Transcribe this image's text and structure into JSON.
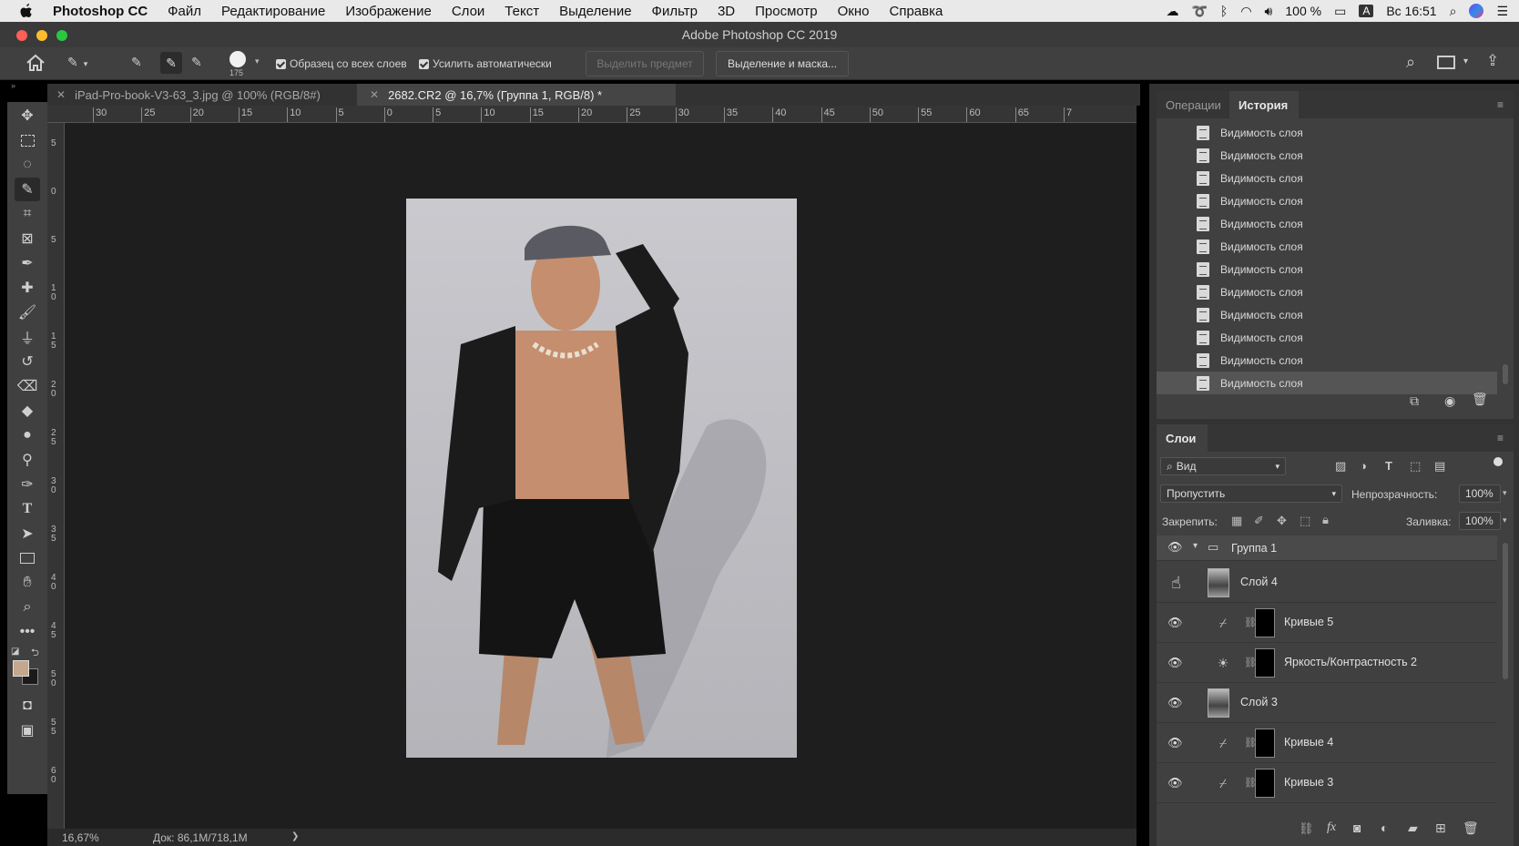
{
  "menubar": {
    "app_name": "Photoshop CC",
    "items": [
      "Файл",
      "Редактирование",
      "Изображение",
      "Слои",
      "Текст",
      "Выделение",
      "Фильтр",
      "3D",
      "Просмотр",
      "Окно",
      "Справка"
    ],
    "battery": "100 %",
    "input_lang": "A",
    "clock": "Вс 16:51"
  },
  "window": {
    "title": "Adobe Photoshop CC 2019"
  },
  "options": {
    "brush_size": "175",
    "sample_all_layers": "Образец со всех слоев",
    "auto_enhance": "Усилить автоматически",
    "select_subject": "Выделить предмет",
    "select_and_mask": "Выделение и маска..."
  },
  "tabs": [
    {
      "label": "iPad-Pro-book-V3-63_3.jpg @ 100% (RGB/8#)"
    },
    {
      "label": "2682.CR2 @ 16,7% (Группа 1, RGB/8) *"
    }
  ],
  "ruler_h": [
    "30",
    "25",
    "20",
    "15",
    "10",
    "5",
    "0",
    "5",
    "10",
    "15",
    "20",
    "25",
    "30",
    "35",
    "40",
    "45",
    "50",
    "55",
    "60",
    "65",
    "7"
  ],
  "ruler_v": [
    "5",
    "0",
    "5",
    "1 0",
    "1 5",
    "2 0",
    "2 5",
    "3 0",
    "3 5",
    "4 0",
    "4 5",
    "5 0",
    "5 5",
    "6 0"
  ],
  "status": {
    "zoom": "16,67%",
    "doc": "Док: 86,1M/718,1M",
    "arrow": "❯"
  },
  "history_panel": {
    "tabs": [
      "Операции",
      "История"
    ],
    "active_tab": "История",
    "items": [
      "Видимость слоя",
      "Видимость слоя",
      "Видимость слоя",
      "Видимость слоя",
      "Видимость слоя",
      "Видимость слоя",
      "Видимость слоя",
      "Видимость слоя",
      "Видимость слоя",
      "Видимость слоя",
      "Видимость слоя",
      "Видимость слоя"
    ]
  },
  "layers_panel": {
    "title": "Слои",
    "filter": "Вид",
    "blend_mode": "Пропустить",
    "opacity_label": "Непрозрачность:",
    "opacity": "100%",
    "lock_label": "Закрепить:",
    "fill_label": "Заливка:",
    "fill": "100%",
    "layers": [
      {
        "name": "Группа 1",
        "kind": "group",
        "visible": true
      },
      {
        "name": "Слой 4",
        "kind": "pixel",
        "visible": false
      },
      {
        "name": "Кривые 5",
        "kind": "curves",
        "visible": true
      },
      {
        "name": "Яркость/Контрастность 2",
        "kind": "brightness",
        "visible": true
      },
      {
        "name": "Слой 3",
        "kind": "pixel",
        "visible": true
      },
      {
        "name": "Кривые 4",
        "kind": "curves",
        "visible": true
      },
      {
        "name": "Кривые 3",
        "kind": "curves",
        "visible": true
      }
    ]
  },
  "colors": {
    "foreground": "#c4a78c",
    "background": "#1a1a1a",
    "accent": "#1473e6"
  }
}
